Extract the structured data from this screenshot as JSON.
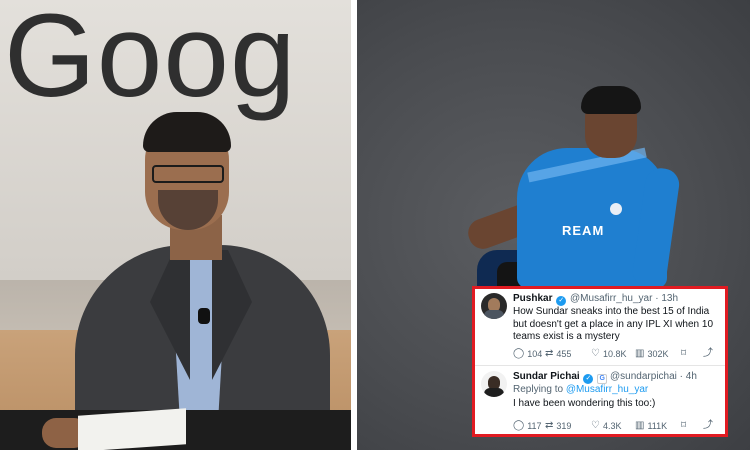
{
  "left_photo": {
    "backdrop_text": "Goog"
  },
  "right_photo": {
    "jersey_text": "REAM"
  },
  "tweets": [
    {
      "name": "Pushkar",
      "handle": "@Musafirr_hu_yar",
      "time": "· 13h",
      "text": "How Sundar sneaks into the best 15 of India but doesn't get a place in any IPL XI when 10 teams exist is a mystery",
      "replies": "104",
      "reposts": "455",
      "likes": "10.8K",
      "views": "302K"
    },
    {
      "name": "Sundar Pichai",
      "handle": "@sundarpichai",
      "time": "· 4h",
      "replying_label": "Replying to",
      "replying_handle": "@Musafirr_hu_yar",
      "text": "I have been wondering this too:)",
      "replies": "117",
      "reposts": "319",
      "likes": "4.3K",
      "views": "111K"
    }
  ],
  "icons": {
    "reply": "speech-bubble",
    "repost": "loop-arrows",
    "like": "heart",
    "views": "bar-chart",
    "bookmark": "bookmark",
    "share": "share"
  },
  "colors": {
    "card_border": "#e11b22",
    "verified": "#1d9bf0",
    "muted": "#536471"
  }
}
